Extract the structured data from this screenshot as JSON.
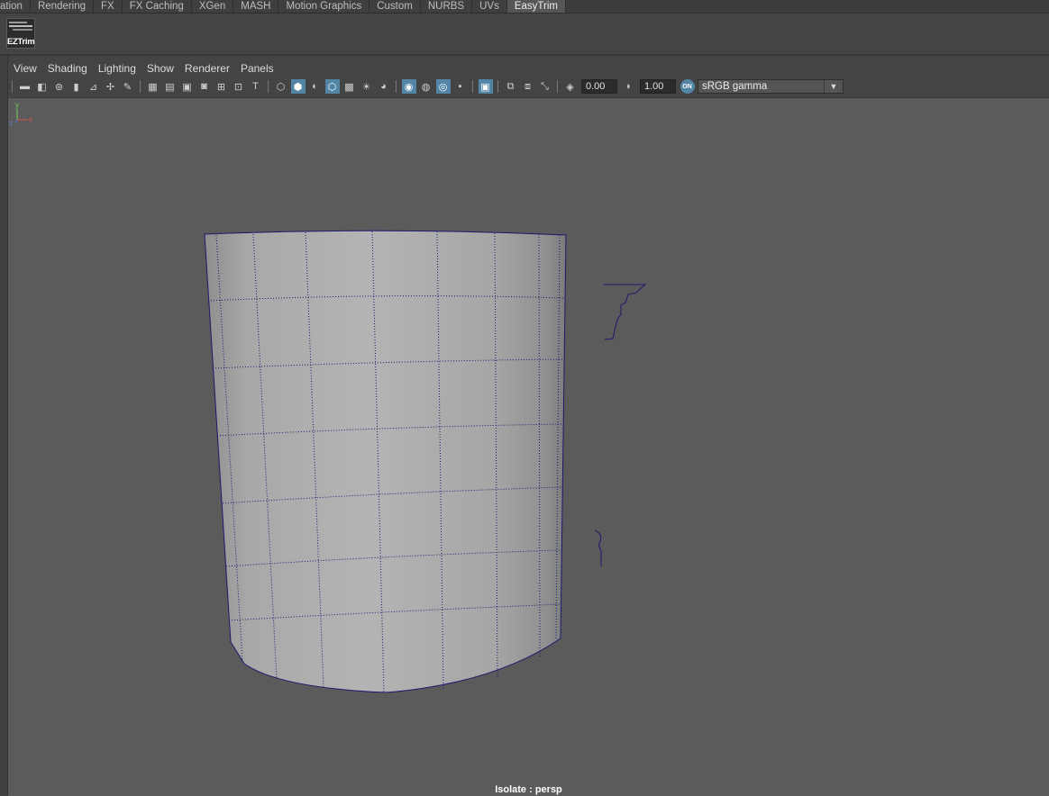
{
  "shelf_tabs": [
    "ation",
    "Rendering",
    "FX",
    "FX Caching",
    "XGen",
    "MASH",
    "Motion Graphics",
    "Custom",
    "NURBS",
    "UVs",
    "EasyTrim"
  ],
  "active_tab": "EasyTrim",
  "shelf": {
    "eztrim_label": "EZTrim"
  },
  "panel_menu": [
    "View",
    "Shading",
    "Lighting",
    "Show",
    "Renderer",
    "Panels"
  ],
  "toolbar": {
    "exposure_value": "0.00",
    "gamma_value": "1.00",
    "color_management_label": "ON",
    "colorspace": "sRGB gamma"
  },
  "viewport": {
    "hud_label": "Isolate : persp",
    "axis": {
      "y": "y",
      "x": "x",
      "z": "z"
    }
  },
  "colors": {
    "viewport_bg": "#5b5b5b",
    "wireframe": "#1a1a6e",
    "active_tool": "#5285a6"
  }
}
